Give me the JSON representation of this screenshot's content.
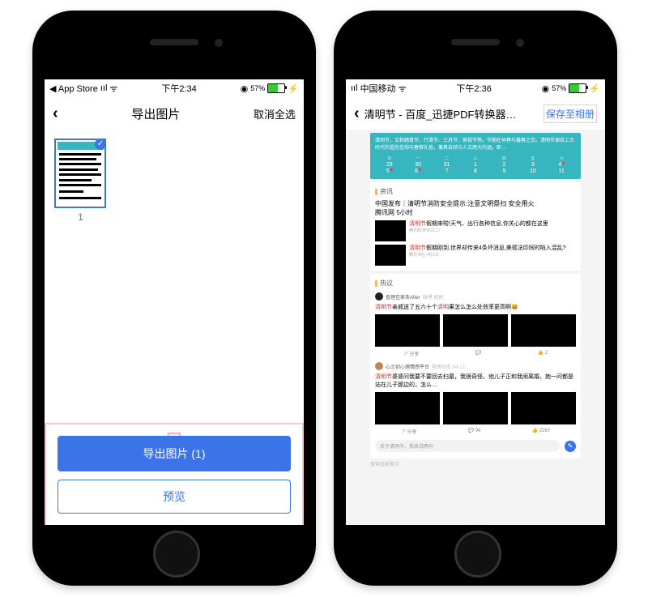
{
  "left": {
    "status": {
      "back_app": "◀ App Store",
      "signal": "ııl",
      "wifi": "ᯤ",
      "time": "下午2:34",
      "batt_pct": "57%"
    },
    "nav": {
      "title": "导出图片",
      "action": "取消全选"
    },
    "thumb_number": "1",
    "export_btn": "导出图片 (1)",
    "preview_btn": "预览"
  },
  "right": {
    "status": {
      "signal": "ııl",
      "carrier": "中国移动",
      "wifi": "ᯤ",
      "time": "下午2:36",
      "batt_pct": "57%"
    },
    "nav": {
      "title": "清明节 - 百度_迅捷PDF转换器…",
      "save": "保存至相册"
    },
    "banner_desc": "清明节，又称踏青节、行清节、三月节、祭祖节等。节期在仲春与暮春之交。清明节源自上古时代的祖先信仰与春祭礼俗，兼具自然与人文两大内涵。即…",
    "cal": {
      "hdr": [
        "日",
        "一",
        "二",
        "三",
        "四",
        "五",
        "六"
      ],
      "row1": [
        "29",
        "30",
        "31",
        "1",
        "2",
        "3",
        "4"
      ],
      "row2": [
        "5",
        "6",
        "7",
        "8",
        "9",
        "10",
        "11"
      ]
    },
    "section_news": "资讯",
    "news_top": {
      "t": "中国发布｜清明节消防安全提示:注意文明祭扫 安全用火",
      "src": "腾讯网 5小时"
    },
    "news1": {
      "t": "清明节假期来啦!天气、出行各种信息,你关心的都在这里",
      "src": "腾讯网 昨天21:17"
    },
    "news2": {
      "t": "清明节假期刚到,世界却传来4条坏消息,美德法印同时陷入混乱?",
      "src": "腾讯书社 4月1日"
    },
    "section_hot": "热议",
    "user1": {
      "name": "查理佳家条After",
      "meta": "微博 刚刚"
    },
    "hot1": "清明节亲戚送了五六十个清明果怎么怎么处效率更高啊😆",
    "react1": {
      "share": "分享",
      "comment": "",
      "like": "2"
    },
    "user2": {
      "name": "心之初心理情感平台",
      "meta": "微博动态 04-17"
    },
    "hot2": "清明节婆婆问我要不要回去扫墓，我很奇怪，他儿子正和我闹离婚，她一问都是站在儿子那边的，怎么…",
    "react2": {
      "share": "分享",
      "comment": "94",
      "like": "2267"
    },
    "comment_placeholder": "关于清明节，我来说两句",
    "footer": "搜索智能聚合"
  }
}
